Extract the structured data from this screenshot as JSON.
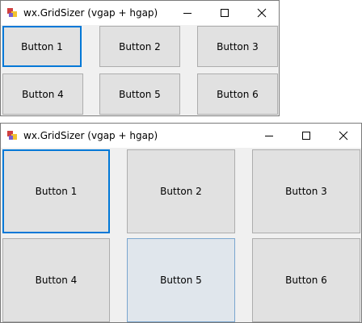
{
  "windows": [
    {
      "title": "wx.GridSizer (vgap + hgap)",
      "buttons": [
        "Button 1",
        "Button 2",
        "Button 3",
        "Button 4",
        "Button 5",
        "Button 6"
      ]
    },
    {
      "title": "wx.GridSizer (vgap + hgap)",
      "buttons": [
        "Button 1",
        "Button 2",
        "Button 3",
        "Button 4",
        "Button 5",
        "Button 6"
      ]
    }
  ],
  "colors": {
    "focus": "#0078d7",
    "button_face": "#e1e1e1",
    "window_bg": "#f0f0f0"
  },
  "icons": {
    "app": "python-app-icon",
    "minimize": "minimize-icon",
    "maximize": "maximize-icon",
    "close": "close-icon"
  }
}
